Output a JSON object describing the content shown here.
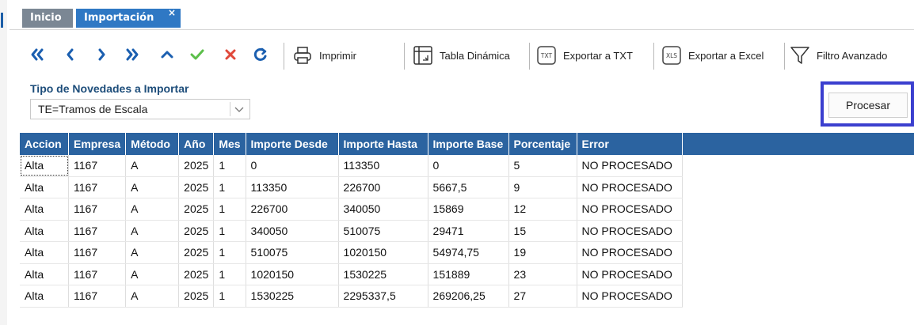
{
  "tabs": [
    {
      "label": "Inicio"
    },
    {
      "label": "Importación",
      "close": "×"
    }
  ],
  "toolbar": {
    "nav_buttons": [
      "first-icon",
      "prev-icon",
      "next-icon",
      "last-icon",
      "up-icon",
      "accept-icon",
      "cancel-icon",
      "refresh-icon"
    ],
    "print_label": "Imprimir",
    "pivot_label": "Tabla Dinámica",
    "export_txt_label": "Exportar a TXT",
    "export_excel_label": "Exportar a Excel",
    "filter_label": "Filtro Avanzado",
    "colors": {
      "nav": "#1b5fb0",
      "accept": "#5cbf4a",
      "cancel": "#e0483a"
    }
  },
  "filter": {
    "label": "Tipo de Novedades a Importar",
    "selected": "TE=Tramos de Escala"
  },
  "process_button": {
    "label": "Procesar",
    "highlight_color": "#3b3fcf"
  },
  "grid": {
    "header_color": "#2b63a0",
    "columns": [
      "Accion",
      "Empresa",
      "Método",
      "Año",
      "Mes",
      "Importe Desde",
      "Importe Hasta",
      "Importe Base",
      "Porcentaje",
      "Error"
    ],
    "rows": [
      [
        "Alta",
        "1167",
        "A",
        "2025",
        "1",
        "0",
        "113350",
        "0",
        "5",
        "NO PROCESADO"
      ],
      [
        "Alta",
        "1167",
        "A",
        "2025",
        "1",
        "113350",
        "226700",
        "5667,5",
        "9",
        "NO PROCESADO"
      ],
      [
        "Alta",
        "1167",
        "A",
        "2025",
        "1",
        "226700",
        "340050",
        "15869",
        "12",
        "NO PROCESADO"
      ],
      [
        "Alta",
        "1167",
        "A",
        "2025",
        "1",
        "340050",
        "510075",
        "29471",
        "15",
        "NO PROCESADO"
      ],
      [
        "Alta",
        "1167",
        "A",
        "2025",
        "1",
        "510075",
        "1020150",
        "54974,75",
        "19",
        "NO PROCESADO"
      ],
      [
        "Alta",
        "1167",
        "A",
        "2025",
        "1",
        "1020150",
        "1530225",
        "151889",
        "23",
        "NO PROCESADO"
      ],
      [
        "Alta",
        "1167",
        "A",
        "2025",
        "1",
        "1530225",
        "2295337,5",
        "269206,25",
        "27",
        "NO PROCESADO"
      ]
    ]
  }
}
